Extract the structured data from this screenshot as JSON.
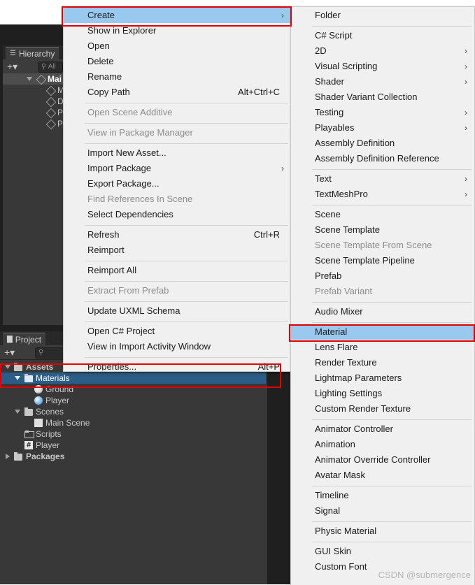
{
  "hierarchy": {
    "tab_label": "Hierarchy",
    "search_placeholder": "All",
    "scene_name": "Mai",
    "children": [
      "M",
      "D",
      "P",
      "P"
    ]
  },
  "project": {
    "tab_label": "Project",
    "tree": {
      "assets": "Assets",
      "materials": "Materials",
      "ground": "Ground",
      "player_material": "Player",
      "scenes": "Scenes",
      "main_scene": "Main Scene",
      "scripts": "Scripts",
      "player_script": "Player",
      "packages": "Packages"
    }
  },
  "context_menu": {
    "create": "Create",
    "show_in_explorer": "Show in Explorer",
    "open": "Open",
    "delete": "Delete",
    "rename": "Rename",
    "copy_path": "Copy Path",
    "copy_path_shortcut": "Alt+Ctrl+C",
    "open_scene_additive": "Open Scene Additive",
    "view_in_package_manager": "View in Package Manager",
    "import_new_asset": "Import New Asset...",
    "import_package": "Import Package",
    "export_package": "Export Package...",
    "find_references": "Find References In Scene",
    "select_dependencies": "Select Dependencies",
    "refresh": "Refresh",
    "refresh_shortcut": "Ctrl+R",
    "reimport": "Reimport",
    "reimport_all": "Reimport All",
    "extract_from_prefab": "Extract From Prefab",
    "update_uxml_schema": "Update UXML Schema",
    "open_csharp_project": "Open C# Project",
    "view_in_import_activity": "View in Import Activity Window",
    "properties": "Properties...",
    "properties_shortcut": "Alt+P"
  },
  "create_submenu": {
    "folder": "Folder",
    "csharp_script": "C# Script",
    "two_d": "2D",
    "visual_scripting": "Visual Scripting",
    "shader": "Shader",
    "shader_variant_collection": "Shader Variant Collection",
    "testing": "Testing",
    "playables": "Playables",
    "assembly_definition": "Assembly Definition",
    "assembly_definition_reference": "Assembly Definition Reference",
    "text": "Text",
    "textmeshpro": "TextMeshPro",
    "scene": "Scene",
    "scene_template": "Scene Template",
    "scene_template_from_scene": "Scene Template From Scene",
    "scene_template_pipeline": "Scene Template Pipeline",
    "prefab": "Prefab",
    "prefab_variant": "Prefab Variant",
    "audio_mixer": "Audio Mixer",
    "material": "Material",
    "lens_flare": "Lens Flare",
    "render_texture": "Render Texture",
    "lightmap_parameters": "Lightmap Parameters",
    "lighting_settings": "Lighting Settings",
    "custom_render_texture": "Custom Render Texture",
    "animator_controller": "Animator Controller",
    "animation": "Animation",
    "animator_override_controller": "Animator Override Controller",
    "avatar_mask": "Avatar Mask",
    "timeline": "Timeline",
    "signal": "Signal",
    "physic_material": "Physic Material",
    "gui_skin": "GUI Skin",
    "custom_font": "Custom Font"
  },
  "watermark": "CSDN @submergence",
  "colors": {
    "highlight": "#99c9ef",
    "annotation_red": "#e00000",
    "selection_blue": "#2c5d87"
  }
}
